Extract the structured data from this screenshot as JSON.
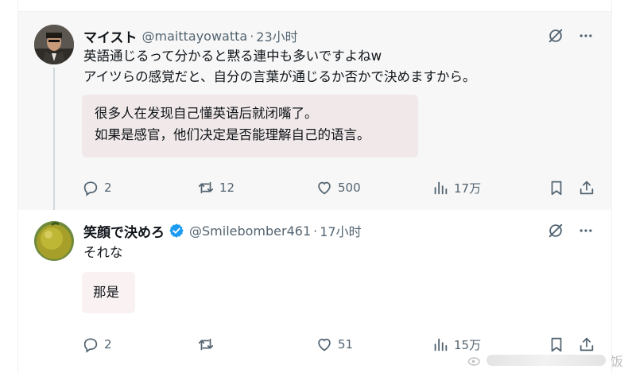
{
  "tweets": [
    {
      "name": "マイスト",
      "handle": "@maittayowatta",
      "dot": "·",
      "time": "23小时",
      "text": [
        "英語通じるって分かると黙る連中も多いですよねw",
        "アイツらの感覚だと、自分の言葉が通じるか否かで決めますから。"
      ],
      "translation": [
        "很多人在发现自己懂英语后就闭嘴了。",
        "如果是感官，他们决定是否能理解自己的语言。"
      ],
      "actions": {
        "replies": "2",
        "retweets": "12",
        "likes": "500",
        "views": "17万"
      }
    },
    {
      "name": "笑顔で決めろ",
      "handle": "@Smilebomber461",
      "dot": "·",
      "time": "17小时",
      "text": [
        "それな"
      ],
      "translation": [
        "那是"
      ],
      "actions": {
        "replies": "2",
        "retweets": "",
        "likes": "51",
        "views": "15万"
      }
    }
  ],
  "watermark": {
    "text": "饭"
  },
  "colors": {
    "verified": "#1d9bf0",
    "muted": "#536471",
    "translation_bg": "#f1e9e9"
  }
}
